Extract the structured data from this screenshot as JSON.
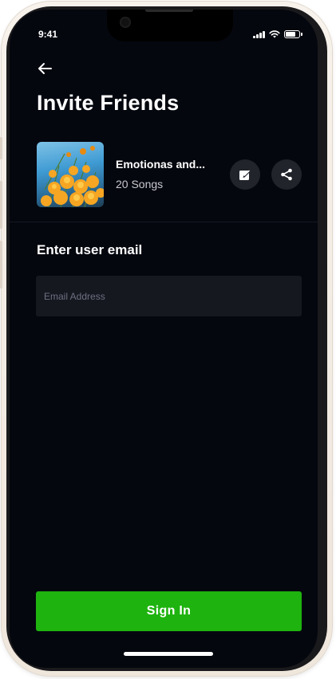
{
  "status_bar": {
    "time": "9:41"
  },
  "header": {
    "title": "Invite Friends"
  },
  "playlist": {
    "name": "Emotionas and...",
    "song_count": "20 Songs"
  },
  "invite": {
    "section_label": "Enter user email",
    "email_placeholder": "Email Address",
    "email_value": ""
  },
  "footer": {
    "primary_button_label": "Sign In"
  },
  "colors": {
    "background": "#05070f",
    "field": "#161820",
    "accent": "#1fb30f",
    "icon_button": "#22242c"
  },
  "icons": [
    "back-arrow-icon",
    "edit-icon",
    "share-icon",
    "signal-icon",
    "wifi-icon",
    "battery-icon"
  ]
}
